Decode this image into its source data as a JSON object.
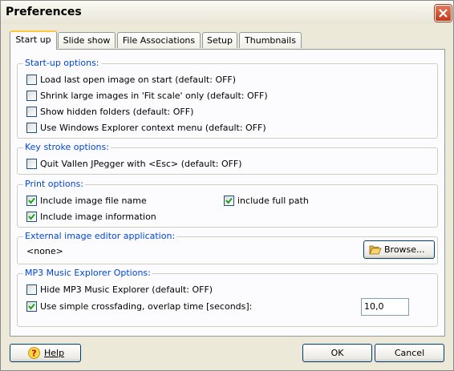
{
  "window": {
    "title": "Preferences"
  },
  "tabs": [
    {
      "label": "Start up",
      "active": true
    },
    {
      "label": "Slide show",
      "active": false
    },
    {
      "label": "File Associations",
      "active": false
    },
    {
      "label": "Setup",
      "active": false
    },
    {
      "label": "Thumbnails",
      "active": false
    }
  ],
  "startup": {
    "label": "Start-up options:",
    "items": [
      {
        "label": "Load last open image on start (default: OFF)",
        "checked": false
      },
      {
        "label": "Shrink large images in 'Fit scale' only (default: OFF)",
        "checked": false
      },
      {
        "label": "Show hidden folders (default: OFF)",
        "checked": false
      },
      {
        "label": "Use Windows Explorer context menu (default: OFF)",
        "checked": false
      }
    ]
  },
  "keystroke": {
    "label": "Key stroke options:",
    "items": [
      {
        "label": "Quit Vallen JPegger with <Esc> (default: OFF)",
        "checked": false
      }
    ]
  },
  "print": {
    "label": "Print options:",
    "include_file_name": {
      "label": "Include image file name",
      "checked": true
    },
    "include_full_path": {
      "label": "include full path",
      "checked": true
    },
    "include_info": {
      "label": "Include image information",
      "checked": true
    }
  },
  "editor": {
    "label": "External image editor application:",
    "value": "<none>",
    "browse_label": "Browse..."
  },
  "mp3": {
    "label": "MP3 Music Explorer Options:",
    "hide": {
      "label": "Hide MP3 Music Explorer (default: OFF)",
      "checked": false
    },
    "crossfade": {
      "label": "Use simple crossfading, overlap time [seconds]:",
      "checked": true
    },
    "overlap_value": "10,0"
  },
  "footer": {
    "help_label": "Help",
    "ok_label": "OK",
    "cancel_label": "Cancel"
  },
  "colors": {
    "group_label": "#0046d5",
    "check": "#21a121",
    "button_border": "#003c74"
  }
}
